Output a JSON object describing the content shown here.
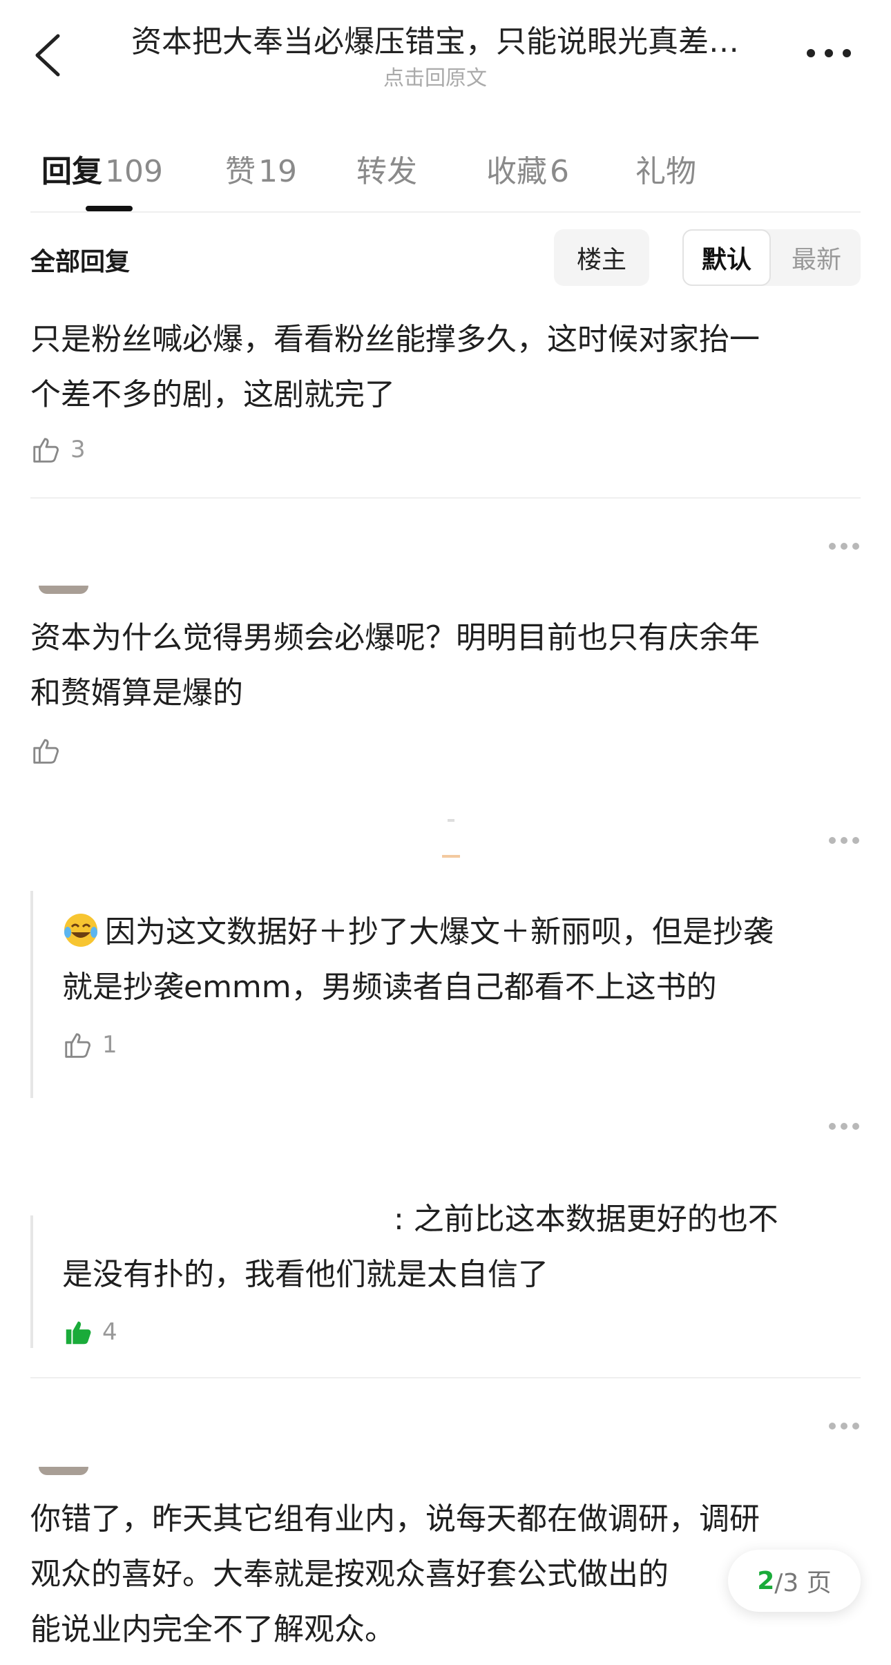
{
  "header": {
    "title": "资本把大奉当必爆压错宝，只能说眼光真差…",
    "subtitle": "点击回原文"
  },
  "tabs": [
    {
      "label": "回复",
      "count": "109"
    },
    {
      "label": "赞",
      "count": "19"
    },
    {
      "label": "转发",
      "count": ""
    },
    {
      "label": "收藏",
      "count": "6"
    },
    {
      "label": "礼物",
      "count": ""
    }
  ],
  "filter": {
    "all_replies": "全部回复",
    "owner": "楼主",
    "default": "默认",
    "latest": "最新"
  },
  "comments": [
    {
      "text_line1": "只是粉丝喊必爆，看看粉丝能撑多久，这时候对家抬一",
      "text_line2": "个差不多的剧，这剧就完了",
      "likes": "3"
    },
    {
      "text_line1": "资本为什么觉得男频会必爆呢？明明目前也只有庆余年",
      "text_line2": "和赘婿算是爆的",
      "likes": ""
    },
    {
      "text_line1": "因为这文数据好＋抄了大爆文＋新丽呗，但是抄袭",
      "text_line2": "就是抄袭emmm，男频读者自己都看不上这书的",
      "likes": "1"
    },
    {
      "text_line1": ": 之前比这本数据更好的也不",
      "text_line2": "是没有扑的，我看他们就是太自信了",
      "likes": "4"
    },
    {
      "text_line1": "你错了，昨天其它组有业内，说每天都在做调研，调研",
      "text_line2": "观众的喜好。大奉就是按观众喜好套公式做出的",
      "text_line3": "能说业内完全不了解观众。"
    }
  ],
  "pager": {
    "current": "2",
    "total": "/3 页"
  },
  "colors": {
    "accent_green": "#1aab3a",
    "muted": "#999999",
    "divider": "#efefef"
  }
}
